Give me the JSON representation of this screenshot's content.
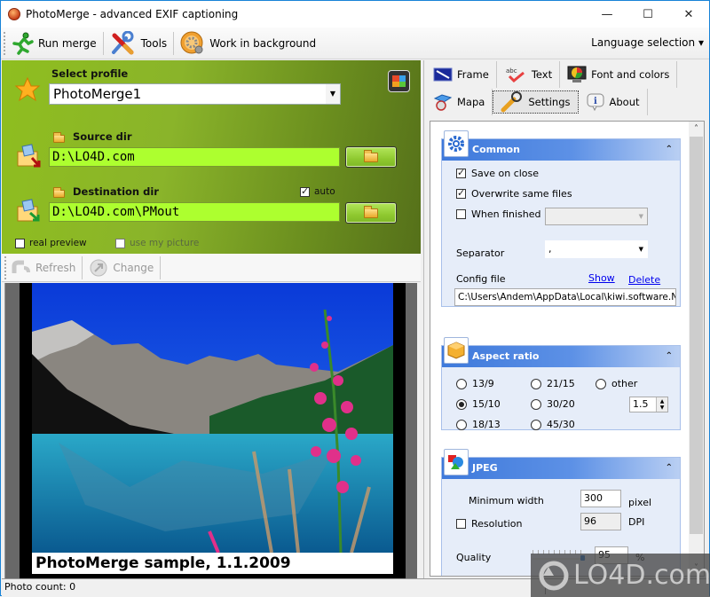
{
  "window": {
    "title": "PhotoMerge - advanced EXIF captioning",
    "controls": {
      "minimize": "—",
      "maximize": "☐",
      "close": "✕"
    }
  },
  "toolbar": {
    "run_merge": "Run merge",
    "tools": "Tools",
    "work_in_background": "Work in background",
    "language_selection": "Language selection",
    "language_arrow": "▾"
  },
  "left": {
    "select_profile_label": "Select profile",
    "profile_value": "PhotoMerge1",
    "profile_arrow": "▼",
    "source_dir_label": "Source dir",
    "source_dir_value": "D:\\LO4D.com",
    "destination_dir_label": "Destination dir",
    "destination_dir_value": "D:\\LO4D.com\\PMout",
    "auto_label": "auto",
    "auto_checked": true,
    "real_preview_label": "real preview",
    "real_preview_checked": false,
    "use_my_picture_label": "use my picture",
    "use_my_picture_checked": false,
    "refresh_label": "Refresh",
    "change_label": "Change",
    "caption": "PhotoMerge sample, 1.1.2009"
  },
  "tabs": {
    "row1": [
      {
        "label": "Frame",
        "icon": "frame-icon"
      },
      {
        "label": "Text",
        "icon": "text-icon"
      },
      {
        "label": "Font and colors",
        "icon": "font-colors-icon"
      }
    ],
    "row2": [
      {
        "label": "Mapa",
        "icon": "map-icon"
      },
      {
        "label": "Settings",
        "icon": "wrench-icon",
        "active": true
      },
      {
        "label": "About",
        "icon": "info-icon"
      }
    ]
  },
  "common": {
    "title": "Common",
    "collapse": "⌃",
    "save_on_close": "Save on close",
    "save_on_close_checked": true,
    "overwrite_same_files": "Overwrite same files",
    "overwrite_checked": true,
    "when_finished": "When finished",
    "when_finished_checked": false,
    "when_finished_value": "",
    "separator_label": "Separator",
    "separator_value": ",",
    "config_file_label": "Config file",
    "show_link": "Show",
    "delete_link": "Delete",
    "config_file_value": "C:\\Users\\Andem\\AppData\\Local\\kiwi.software.NET\\P"
  },
  "aspect": {
    "title": "Aspect ratio",
    "options": [
      {
        "label": "13/9",
        "selected": false
      },
      {
        "label": "21/15",
        "selected": false
      },
      {
        "label": "other",
        "selected": false
      },
      {
        "label": "15/10",
        "selected": true
      },
      {
        "label": "30/20",
        "selected": false
      },
      {
        "label": "18/13",
        "selected": false
      },
      {
        "label": "45/30",
        "selected": false
      }
    ],
    "other_value": "1.5"
  },
  "jpeg": {
    "title": "JPEG",
    "min_width_label": "Minimum width",
    "min_width_value": "300",
    "min_width_unit": "pixel",
    "resolution_label": "Resolution",
    "resolution_checked": false,
    "resolution_value": "96",
    "resolution_unit": "DPI",
    "quality_label": "Quality",
    "quality_value": "95",
    "quality_unit": "%",
    "quality_slider_fraction": 0.95
  },
  "status": {
    "photo_count": "Photo count: 0"
  },
  "watermark": "LO4D.com",
  "colors": {
    "green_panel": "#8ab42a",
    "dir_field": "#adff2f",
    "group_header": "#3e79db",
    "group_bg": "#e6edf9",
    "link": "#0000ee"
  }
}
